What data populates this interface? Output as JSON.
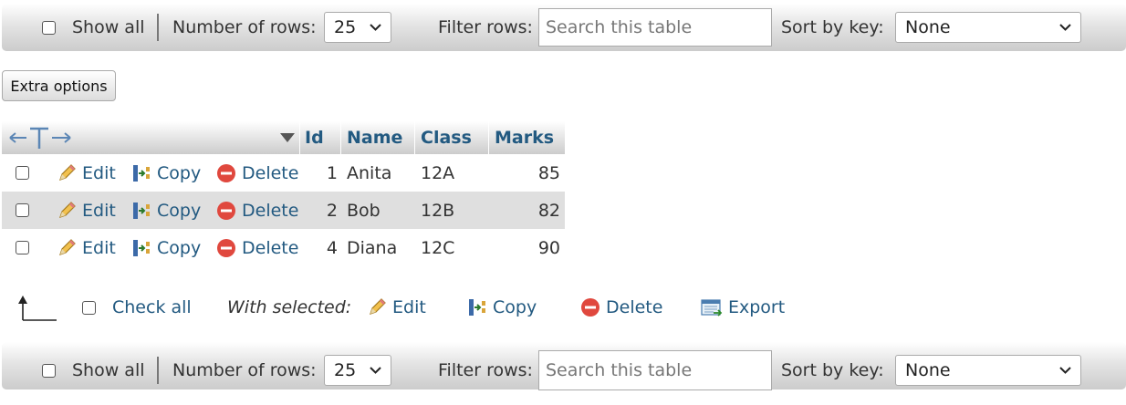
{
  "navbar": {
    "show_all": "Show all",
    "rows_label": "Number of rows:",
    "rows_value": "25",
    "filter_label": "Filter rows:",
    "search_placeholder": "Search this table",
    "sort_label": "Sort by key:",
    "sort_value": "None"
  },
  "extra_options": "Extra options",
  "table": {
    "columns": [
      "Id",
      "Name",
      "Class",
      "Marks"
    ],
    "actions": {
      "edit": "Edit",
      "copy": "Copy",
      "delete": "Delete"
    },
    "rows": [
      {
        "id": "1",
        "name": "Anita",
        "class": "12A",
        "marks": "85"
      },
      {
        "id": "2",
        "name": "Bob",
        "class": "12B",
        "marks": "82"
      },
      {
        "id": "4",
        "name": "Diana",
        "class": "12C",
        "marks": "90"
      }
    ]
  },
  "footer": {
    "check_all": "Check all",
    "with_selected": "With selected:",
    "edit": "Edit",
    "copy": "Copy",
    "delete": "Delete",
    "export": "Export"
  },
  "colors": {
    "link": "#235a81",
    "delete_red": "#e0483e",
    "row_alt": "#dfdfdf"
  }
}
